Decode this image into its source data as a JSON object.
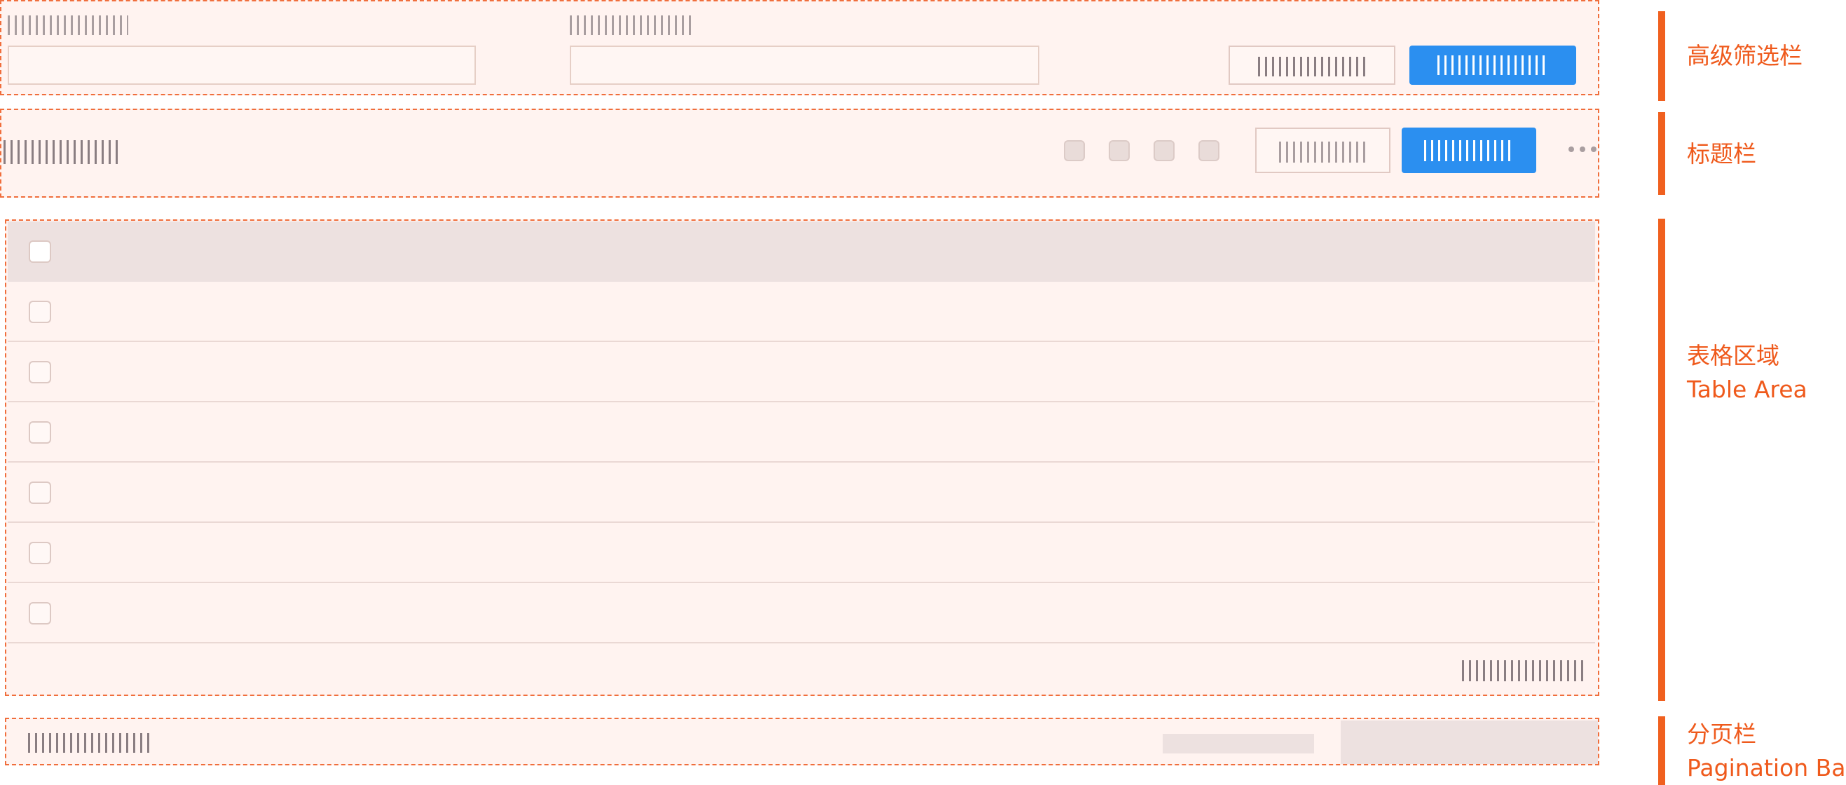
{
  "annotations": [
    {
      "id": "filter",
      "lines": [
        "高级筛选栏"
      ]
    },
    {
      "id": "title",
      "lines": [
        "标题栏"
      ]
    },
    {
      "id": "table",
      "lines": [
        "表格区域",
        "Table Area"
      ]
    },
    {
      "id": "pagination",
      "lines": [
        "分页栏",
        "Pagination Bar"
      ]
    }
  ],
  "table": {
    "header_row": {
      "has_checkbox": true
    },
    "body_row_count": 6
  },
  "colors": {
    "region_border": "#f06e3c",
    "region_fill": "#fff3f0",
    "primary_button": "#2b8ff0",
    "annotation": "#ef5a1c",
    "placeholder_text": "#8a7e82"
  },
  "icons": [
    "more-horizontal-icon"
  ]
}
